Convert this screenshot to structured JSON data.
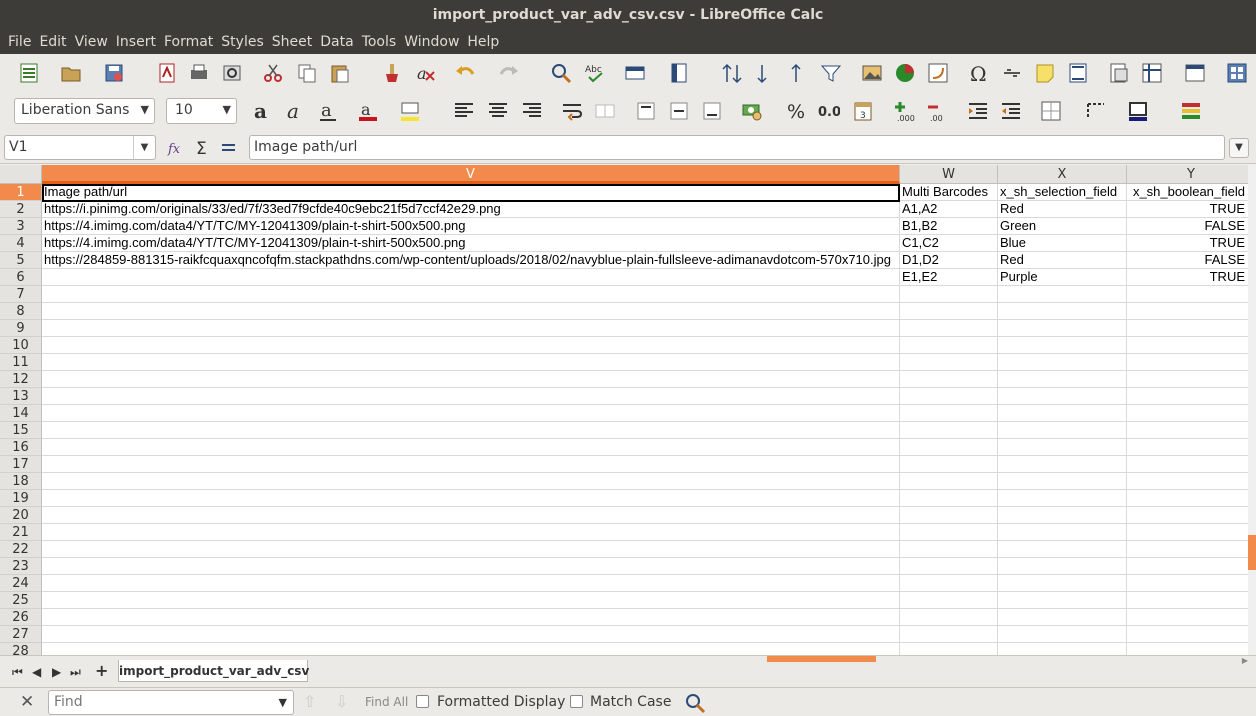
{
  "window": {
    "title": "import_product_var_adv_csv.csv - LibreOffice Calc"
  },
  "menu": [
    "File",
    "Edit",
    "View",
    "Insert",
    "Format",
    "Styles",
    "Sheet",
    "Data",
    "Tools",
    "Window",
    "Help"
  ],
  "format": {
    "font_name": "Liberation Sans",
    "font_size": "10"
  },
  "formula_bar": {
    "cell_ref": "V1",
    "content": "Image path/url"
  },
  "columns": [
    "V",
    "W",
    "X",
    "Y"
  ],
  "selected_column": "V",
  "rows": [
    "1",
    "2",
    "3",
    "4",
    "5",
    "6",
    "7",
    "8",
    "9",
    "10",
    "11",
    "12",
    "13",
    "14",
    "15",
    "16",
    "17",
    "18",
    "19",
    "20",
    "21",
    "22",
    "23",
    "24",
    "25",
    "26",
    "27",
    "28"
  ],
  "cells": [
    [
      "Image path/url",
      "Multi Barcodes",
      "x_sh_selection_field",
      "x_sh_boolean_field"
    ],
    [
      "https://i.pinimg.com/originals/33/ed/7f/33ed7f9cfde40c9ebc21f5d7ccf42e29.png",
      "A1,A2",
      "Red",
      "TRUE"
    ],
    [
      "https://4.imimg.com/data4/YT/TC/MY-12041309/plain-t-shirt-500x500.png",
      "B1,B2",
      "Green",
      "FALSE"
    ],
    [
      "https://4.imimg.com/data4/YT/TC/MY-12041309/plain-t-shirt-500x500.png",
      "C1,C2",
      "Blue",
      "TRUE"
    ],
    [
      "https://284859-881315-raikfcquaxqncofqfm.stackpathdns.com/wp-content/uploads/2018/02/navyblue-plain-fullsleeve-adimanavdotcom-570x710.jpg",
      "D1,D2",
      "Red",
      "FALSE"
    ],
    [
      "",
      "E1,E2",
      "Purple",
      "TRUE"
    ]
  ],
  "sheet_tab": "import_product_var_adv_csv",
  "findbar": {
    "placeholder": "Find",
    "find_all": "Find All",
    "formatted_display": "Formatted Display",
    "match_case": "Match Case"
  },
  "colors": {
    "accent": "#f28a4c",
    "titlebar": "#3d3c38"
  }
}
